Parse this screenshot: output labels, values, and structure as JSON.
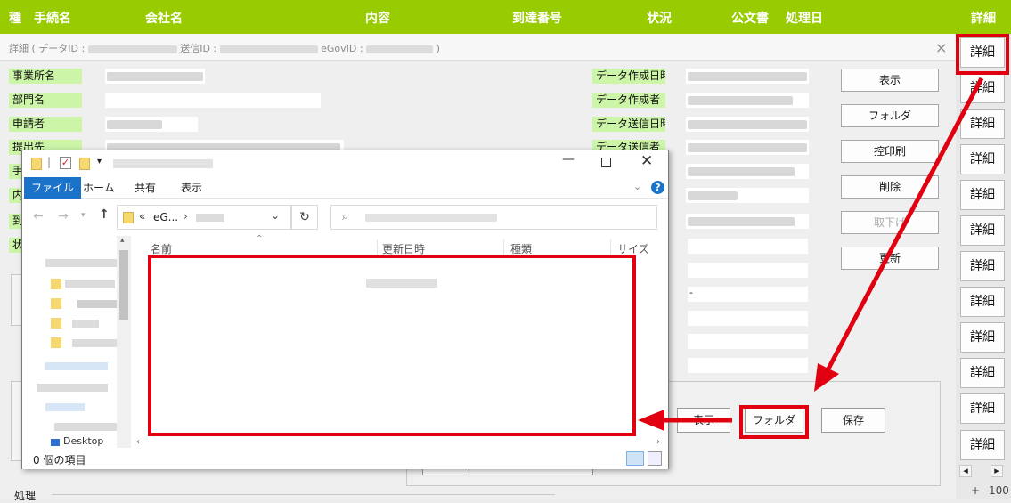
{
  "header": {
    "col_kind": "種",
    "col_procedure": "手続名",
    "col_company": "会社名",
    "col_content": "内容",
    "col_arrival": "到達番号",
    "col_status": "状況",
    "col_document": "公文書",
    "col_processed": "処理日",
    "col_detail": "詳細"
  },
  "detail_buttons": [
    "詳細",
    "詳細",
    "詳細",
    "詳細",
    "詳細",
    "詳細",
    "詳細",
    "詳細",
    "詳細",
    "詳細",
    "詳細",
    "詳細"
  ],
  "detail_panel": {
    "title_prefix": "詳細 ( データID :",
    "title_send_id": "送信ID :",
    "title_egov_id": "eGovID :",
    "title_suffix": ")",
    "close_glyph": "×",
    "left_labels": [
      "事業所名",
      "部門名",
      "申請者",
      "提出先",
      "手",
      "内",
      "到",
      "状"
    ],
    "right_labels": [
      "データ作成日時",
      "データ作成者",
      "データ送信日時",
      "データ送信者"
    ],
    "value_dash": "-",
    "actions": {
      "show": "表示",
      "folder": "フォルダ",
      "print_copy": "控印刷",
      "delete": "削除",
      "withdraw": "取下げ",
      "refresh": "更新"
    },
    "lower": {
      "show": "表示",
      "folder": "フォルダ",
      "save": "保存"
    },
    "process_label": "処理"
  },
  "explorer": {
    "title_sep": "|",
    "ribbon_tabs": [
      "ファイル",
      "ホーム",
      "共有",
      "表示"
    ],
    "address_prefix": "«",
    "address_crumb": "eG...",
    "columns": {
      "name": "名前",
      "modified": "更新日時",
      "type": "種類",
      "size": "サイズ"
    },
    "status_text": "0 個の項目",
    "nav_partial": "Desktop",
    "help_glyph": "?"
  },
  "scroll": {
    "plus": "+",
    "zoom_partial": "100"
  },
  "colors": {
    "header_green": "#99cc00",
    "label_green": "#ccf5a8",
    "highlight_red": "#e00010",
    "ribbon_blue": "#1a73c8"
  }
}
